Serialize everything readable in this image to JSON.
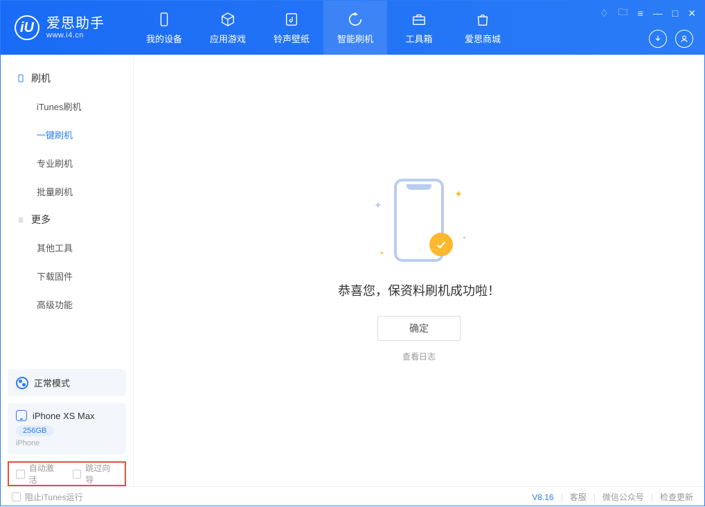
{
  "app": {
    "title": "爱思助手",
    "subtitle": "www.i4.cn",
    "logo_letter": "iU"
  },
  "nav": [
    {
      "label": "我的设备",
      "icon": "device"
    },
    {
      "label": "应用游戏",
      "icon": "cube"
    },
    {
      "label": "铃声壁纸",
      "icon": "music"
    },
    {
      "label": "智能刷机",
      "icon": "refresh"
    },
    {
      "label": "工具箱",
      "icon": "toolbox"
    },
    {
      "label": "爱思商城",
      "icon": "bag"
    }
  ],
  "sidebar": {
    "group1_title": "刷机",
    "group1_items": [
      "iTunes刷机",
      "一键刷机",
      "专业刷机",
      "批量刷机"
    ],
    "group2_title": "更多",
    "group2_items": [
      "其他工具",
      "下载固件",
      "高级功能"
    ]
  },
  "mode": {
    "label": "正常模式"
  },
  "device": {
    "name": "iPhone XS Max",
    "storage": "256GB",
    "type": "iPhone"
  },
  "options": {
    "auto_activate": "自动激活",
    "skip_guide": "跳过向导"
  },
  "main": {
    "success_title": "恭喜您，保资料刷机成功啦！",
    "ok_button": "确定",
    "view_log": "查看日志"
  },
  "footer": {
    "block_itunes": "阻止iTunes运行",
    "version": "V8.16",
    "links": [
      "客服",
      "微信公众号",
      "检查更新"
    ]
  }
}
